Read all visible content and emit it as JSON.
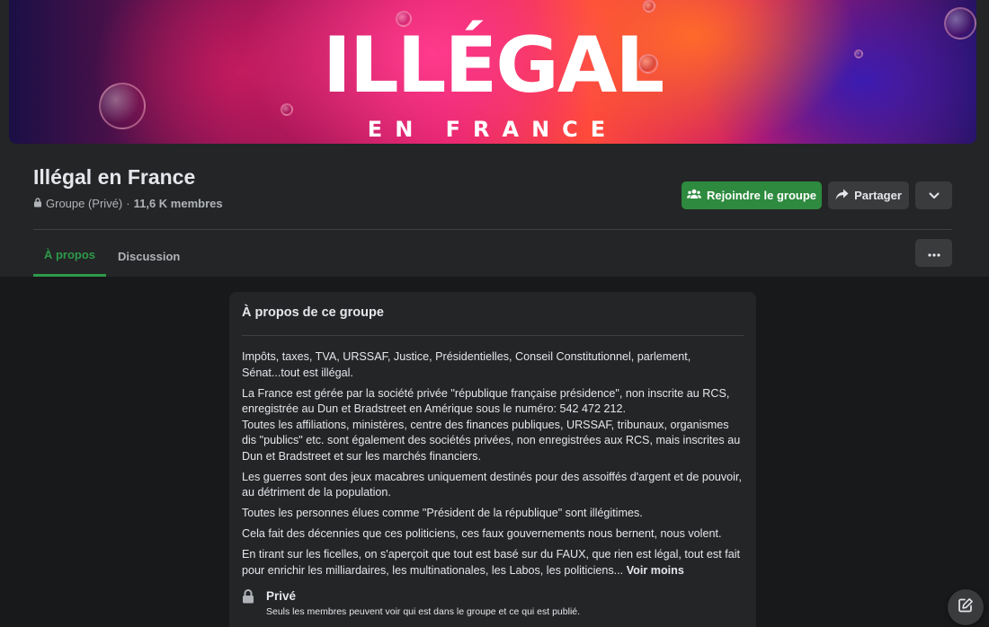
{
  "cover": {
    "title": "ILLÉGAL",
    "subtitle": "EN FRANCE"
  },
  "group": {
    "name": "Illégal en France",
    "privacy": "Groupe (Privé)",
    "separator": "·",
    "members": "11,6 K membres"
  },
  "actions": {
    "join_label": "Rejoindre le groupe",
    "share_label": "Partager",
    "more_icon": "chevron-down-icon",
    "join_color": "#2d8a3e"
  },
  "tabs": [
    {
      "label": "À propos",
      "active": true
    },
    {
      "label": "Discussion",
      "active": false
    }
  ],
  "tab_options_icon": "ellipsis-icon",
  "about": {
    "title": "À propos de ce groupe",
    "paragraphs": [
      "Impôts, taxes, TVA, URSSAF, Justice, Présidentielles, Conseil Constitutionnel, parlement, Sénat...tout est illégal.",
      "La France est gérée par la société privée \"république française présidence\", non inscrite au RCS, enregistrée au Dun et Bradstreet en Amérique sous le numéro: 542 472 212.",
      "Toutes les affiliations, ministères, centre des finances publiques, URSSAF, tribunaux, organismes dis \"publics\" etc. sont également des sociétés privées, non enregistrées aux RCS, mais inscrites au Dun et Bradstreet et sur les marchés financiers.",
      "Les guerres sont des jeux macabres uniquement destinés pour des assoiffés d'argent et de pouvoir, au détriment de la population.",
      "Toutes les personnes élues comme \"Président de la république\" sont illégitimes.",
      "Cela fait des décennies que ces politiciens, ces faux gouvernements nous bernent, nous volent.",
      "En tirant sur les ficelles, on s'aperçoit que tout est basé sur du FAUX, que rien est légal, tout est fait pour enrichir les milliardaires, les multinationales, les Labos, les politiciens..."
    ],
    "see_less": "Voir moins",
    "privacy_title": "Privé",
    "privacy_desc": "Seuls les membres peuvent voir qui est dans le groupe et ce qui est publié."
  },
  "colors": {
    "accent_green": "#2d9a4a",
    "background": "#18191a",
    "panel": "#242526"
  }
}
